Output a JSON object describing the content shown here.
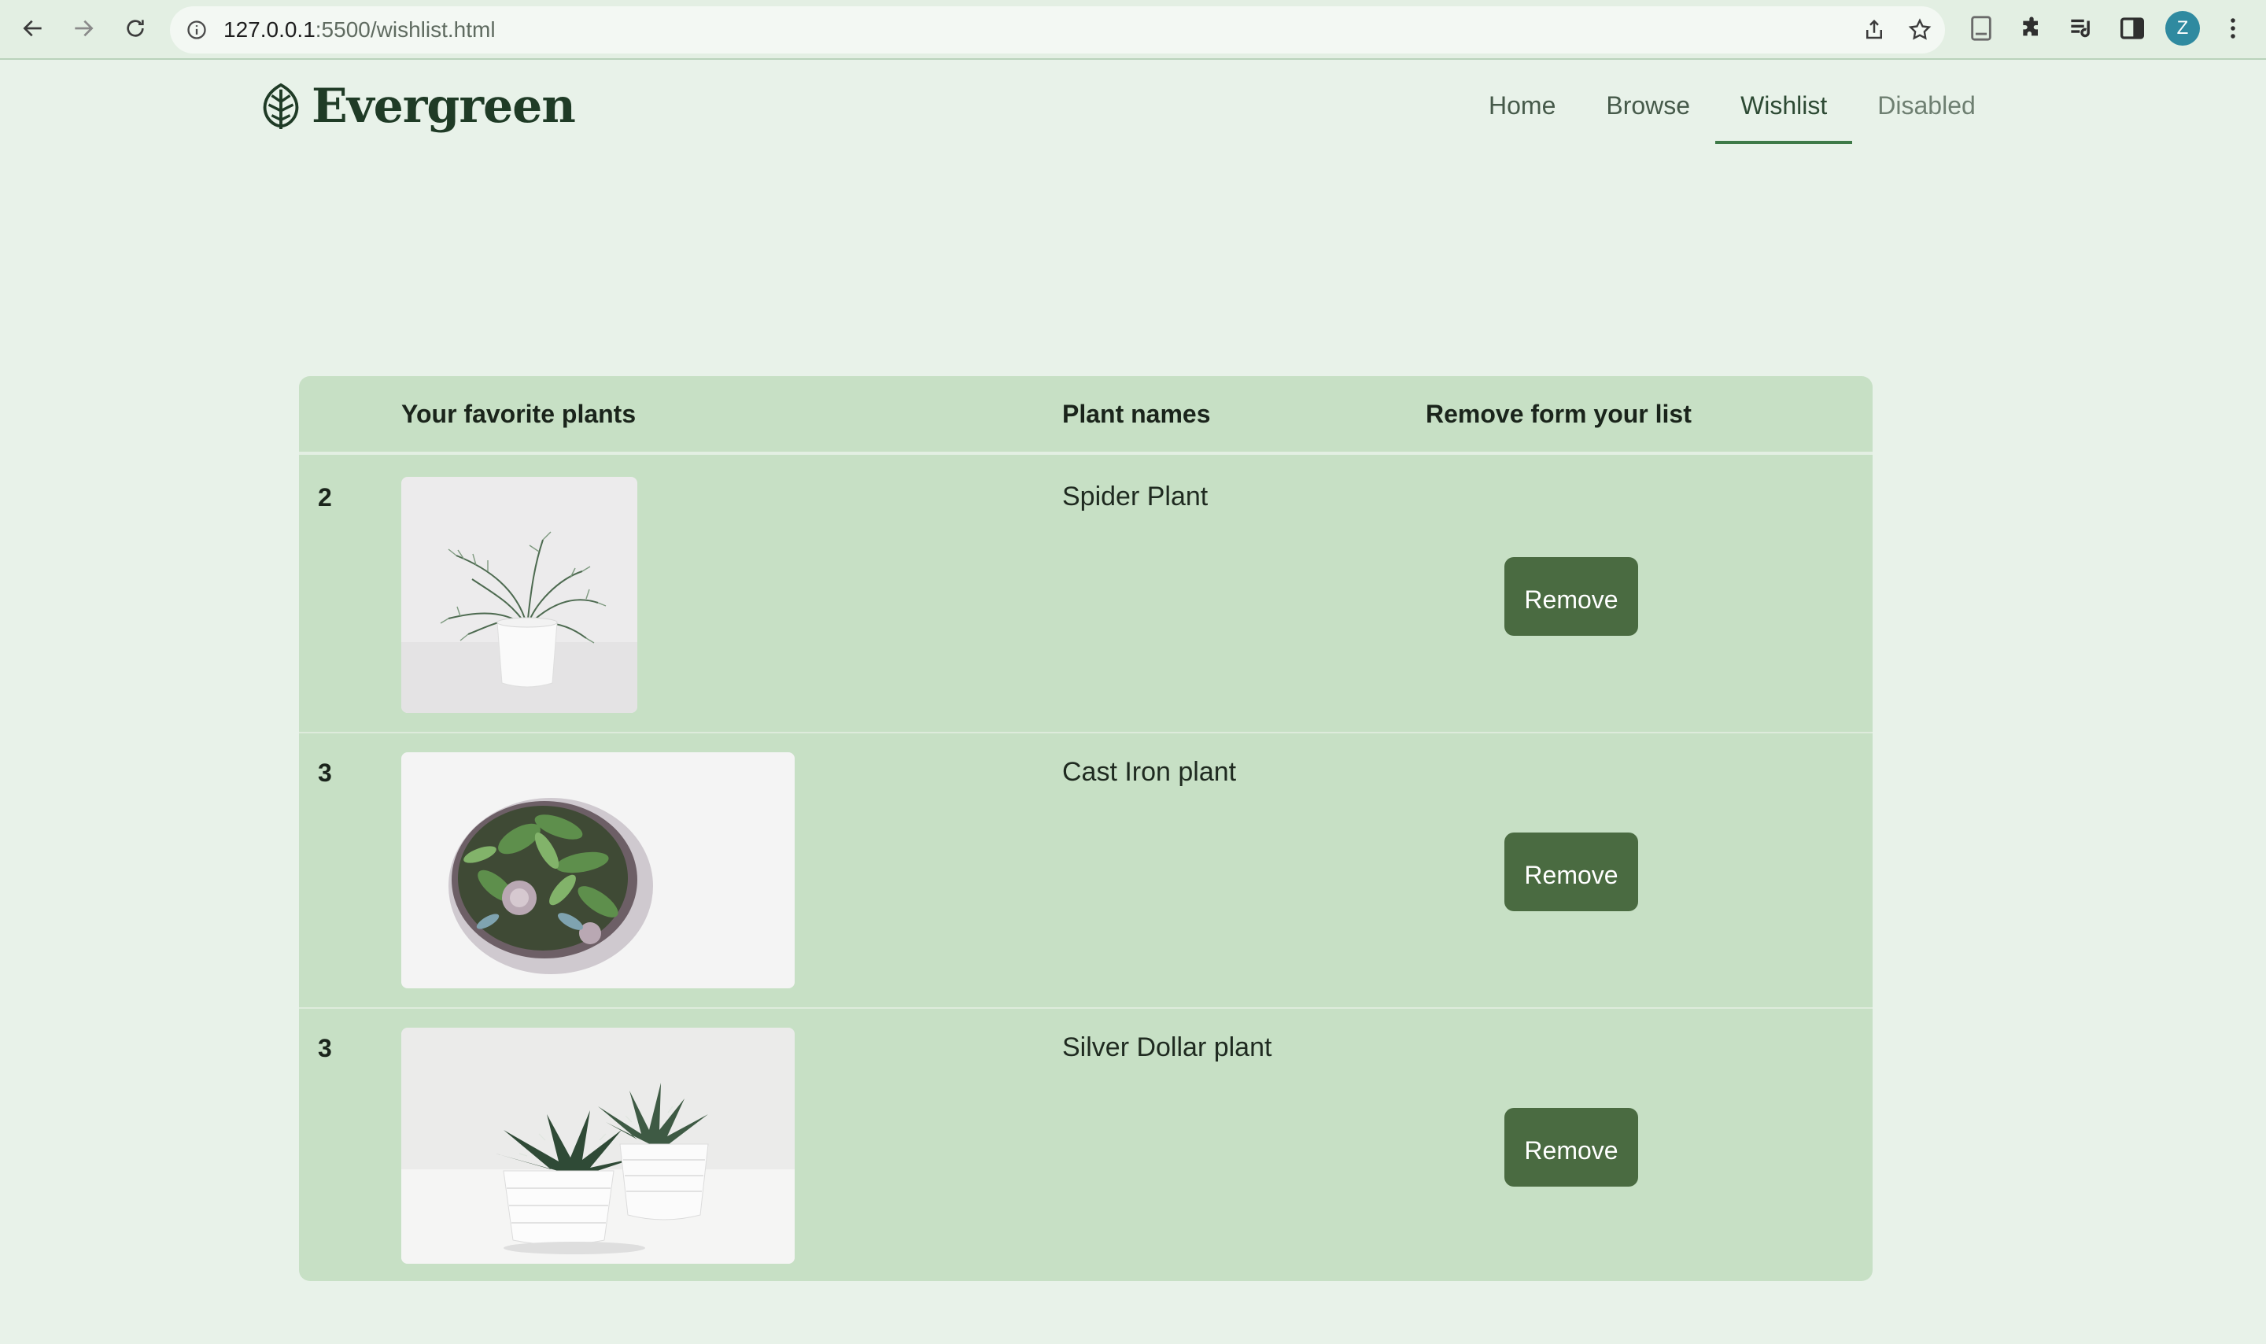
{
  "browser": {
    "url_host": "127.0.0.1",
    "url_rest": ":5500/wishlist.html",
    "profile_initial": "Z"
  },
  "brand": {
    "name": "Evergreen"
  },
  "nav": {
    "items": [
      {
        "label": "Home",
        "state": "default"
      },
      {
        "label": "Browse",
        "state": "default"
      },
      {
        "label": "Wishlist",
        "state": "active"
      },
      {
        "label": "Disabled",
        "state": "disabled"
      }
    ]
  },
  "table": {
    "headers": {
      "favorites": "Your favorite plants",
      "names": "Plant names",
      "remove": "Remove form your list"
    },
    "rows": [
      {
        "number": "2",
        "name": "Spider Plant",
        "image": "potted-grass-plant",
        "button": "Remove"
      },
      {
        "number": "3",
        "name": "Cast Iron plant",
        "image": "terrarium-bowl",
        "button": "Remove"
      },
      {
        "number": "3",
        "name": "Silver Dollar plant",
        "image": "two-succulent-pots",
        "button": "Remove"
      }
    ]
  },
  "colors": {
    "background": "#e8f2e9",
    "table_bg": "#c7e0c5",
    "button_bg": "#4a6b41",
    "brand_text": "#1f3b26",
    "active_underline": "#3e7a48"
  }
}
